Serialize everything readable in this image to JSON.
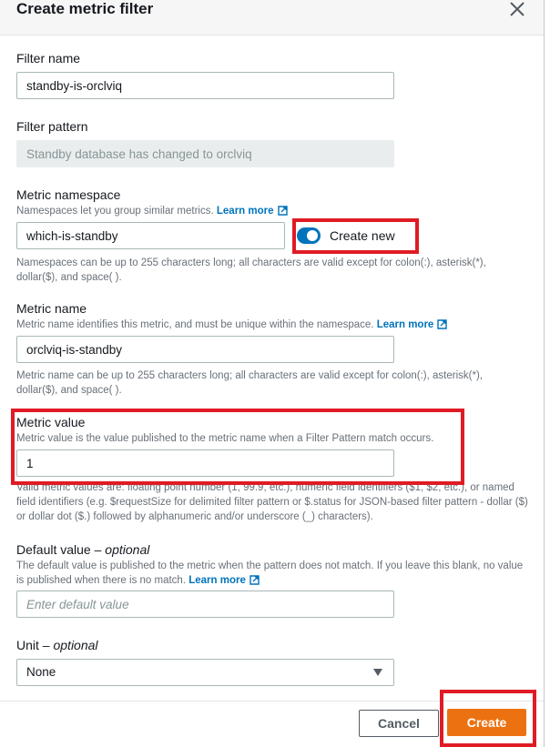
{
  "modal": {
    "title": "Create metric filter",
    "close_icon": "close-icon"
  },
  "fields": {
    "filter_name": {
      "label": "Filter name",
      "value": "standby-is-orclviq"
    },
    "filter_pattern": {
      "label": "Filter pattern",
      "value": "Standby database has changed to orclviq",
      "disabled": true
    },
    "metric_namespace": {
      "label": "Metric namespace",
      "description": "Namespaces let you group similar metrics.",
      "learn_more": "Learn more",
      "value": "which-is-standby",
      "toggle_label": "Create new",
      "toggle_on": true,
      "constraint": "Namespaces can be up to 255 characters long; all characters are valid except for colon(:), asterisk(*), dollar($), and space( )."
    },
    "metric_name": {
      "label": "Metric name",
      "description": "Metric name identifies this metric, and must be unique within the namespace.",
      "learn_more": "Learn more",
      "value": "orclviq-is-standby",
      "constraint": "Metric name can be up to 255 characters long; all characters are valid except for colon(:), asterisk(*), dollar($), and space( )."
    },
    "metric_value": {
      "label": "Metric value",
      "description": "Metric value is the value published to the metric name when a Filter Pattern match occurs.",
      "value": "1",
      "constraint": "Valid metric values are: floating point number (1, 99.9, etc.), numeric field identifiers ($1, $2, etc.), or named field identifiers (e.g. $requestSize for delimited filter pattern or $.status for JSON-based filter pattern - dollar ($) or dollar dot ($.) followed by alphanumeric and/or underscore (_) characters)."
    },
    "default_value": {
      "label": "Default value",
      "optional": "optional",
      "description": "The default value is published to the metric when the pattern does not match. If you leave this blank, no value is published when there is no match.",
      "learn_more": "Learn more",
      "placeholder": "Enter default value",
      "value": ""
    },
    "unit": {
      "label": "Unit",
      "optional": "optional",
      "selected": "None"
    }
  },
  "footer": {
    "cancel_label": "Cancel",
    "create_label": "Create"
  },
  "colors": {
    "primary_button": "#ec7211",
    "link": "#0073bb",
    "toggle_on": "#0073bb",
    "highlight": "#e01b24"
  }
}
